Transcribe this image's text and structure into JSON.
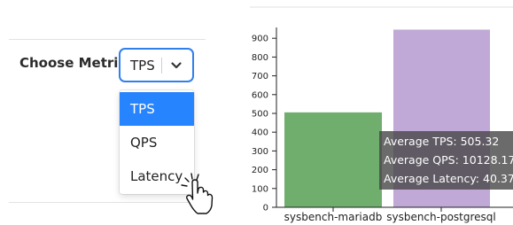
{
  "controls": {
    "metric_label": "Choose Metric:",
    "selected_value": "TPS",
    "options": [
      "TPS",
      "QPS",
      "Latency"
    ],
    "highlighted_option": "TPS",
    "accent_color": "#2f80ed",
    "highlight_color": "#2684ff"
  },
  "chart_data": {
    "type": "bar",
    "categories": [
      "sysbench-mariadb",
      "sysbench-postgresql"
    ],
    "values": [
      505.32,
      946
    ],
    "colors": [
      "#6fae6d",
      "#c0a9d6"
    ],
    "ylim": [
      0,
      950
    ],
    "yticks": [
      0,
      100,
      200,
      300,
      400,
      500,
      600,
      700,
      800,
      900
    ],
    "xlabel": "",
    "ylabel": "",
    "tooltip": [
      "Average TPS: 505.32",
      "Average QPS: 10128.17",
      "Average Latency: 40.37"
    ]
  }
}
